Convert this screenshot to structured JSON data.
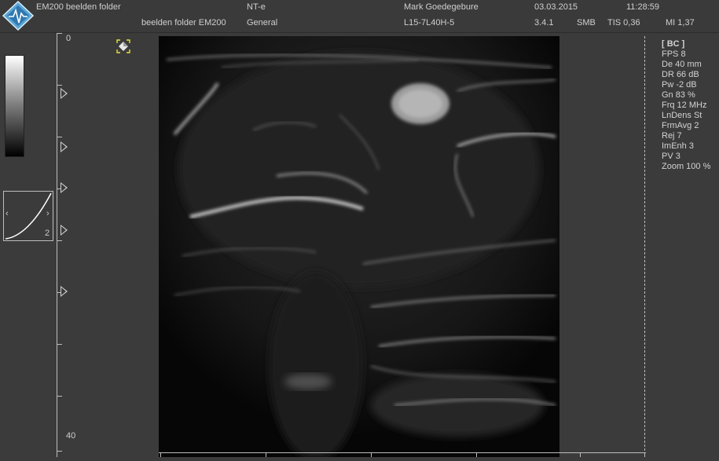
{
  "header": {
    "app_title": "EM200 beelden folder",
    "folder": "beelden folder EM200",
    "mode": "NT-e",
    "preset": "General",
    "operator": "Mark Goedegebure",
    "probe": "L15-7L40H-5",
    "date": "03.03.2015",
    "version": "3.4.1",
    "time": "11:28:59",
    "smb": "SMB",
    "tis": "TIS 0,36",
    "mi": "MI 1,37"
  },
  "depth_scale": {
    "top": "0",
    "bottom": "40"
  },
  "curve": {
    "value": "2",
    "left_arrow": "‹",
    "right_arrow": "›"
  },
  "params": {
    "mode": "[ BC ]",
    "fps": "FPS 8",
    "depth": "De 40 mm",
    "dr": "DR 66 dB",
    "pw": "Pw -2 dB",
    "gain": "Gn 83 %",
    "frq": "Frq 12 MHz",
    "lndens": "LnDens St",
    "frmavg": "FrmAvg 2",
    "rej": "Rej 7",
    "imenh": "ImEnh 3",
    "pv": "PV 3",
    "zoom": "Zoom 100 %"
  }
}
